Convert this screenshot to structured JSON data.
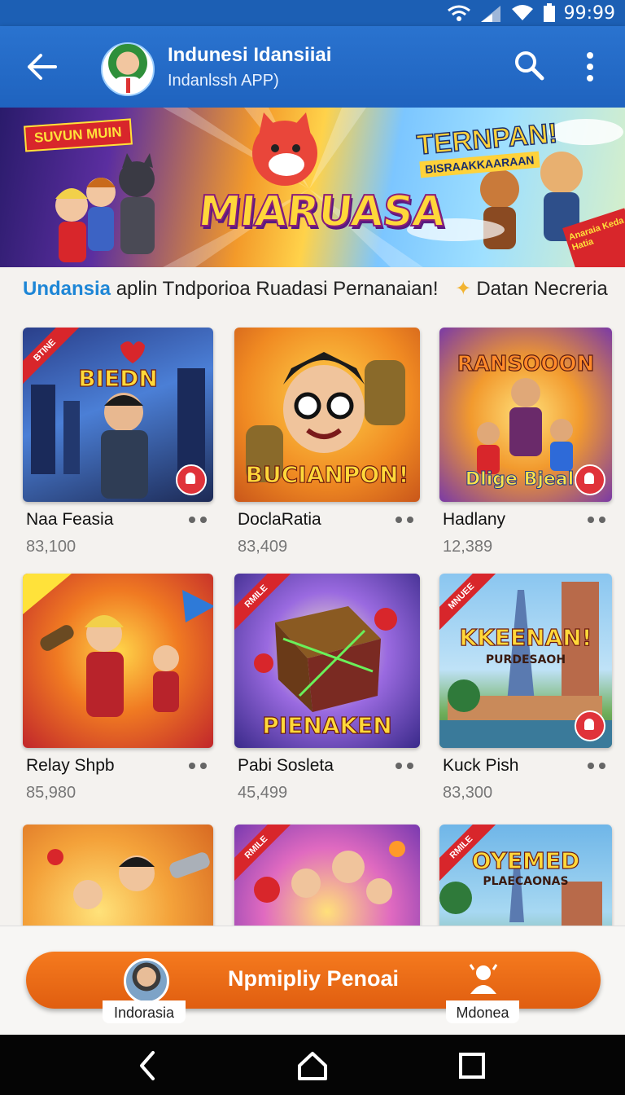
{
  "status_bar": {
    "time": "99:99"
  },
  "header": {
    "title": "Indunesi Idansiiai",
    "subtitle": "Indanlssh APP)"
  },
  "banner": {
    "tag": "SUVUN MUIN",
    "main_title": "MIARUASA",
    "side_title": "TERNPAN!",
    "side_subtitle": "BISRAAKKAARAAN",
    "corner_text": "Anaraia Keda Hatia"
  },
  "tagline": {
    "brand": "Undansia",
    "text": "aplin Tndporioa Ruadasi Pernanaian!",
    "extra": "Datan Necreria"
  },
  "games": [
    {
      "name": "Naa Feasia",
      "count": "83,100",
      "art_title": "BIEDN",
      "ribbon": "BTINE"
    },
    {
      "name": "DoclaRatia",
      "count": "83,409",
      "art_title": "BUCIANPON!",
      "ribbon": ""
    },
    {
      "name": "Hadlany",
      "count": "12,389",
      "art_title": "RANSOOON",
      "art_title2": "Dlige Bjeale",
      "ribbon": ""
    },
    {
      "name": "Relay Shpb",
      "count": "85,980",
      "art_title": "",
      "ribbon": ""
    },
    {
      "name": "Pabi Sosleta",
      "count": "45,499",
      "art_title": "PIENAKEN",
      "ribbon": "RMILE"
    },
    {
      "name": "Kuck Pish",
      "count": "83,300",
      "art_title": "KKEENAN!",
      "art_title2": "PURDESAOH",
      "ribbon": "MNUEE"
    },
    {
      "name": "",
      "count": "",
      "art_title": "",
      "ribbon": ""
    },
    {
      "name": "",
      "count": "",
      "art_title": "",
      "ribbon": "RMILE"
    },
    {
      "name": "",
      "count": "",
      "art_title": "OYEMED",
      "art_title2": "PLAECAONAS",
      "ribbon": "RMILE"
    }
  ],
  "cta": {
    "label": "Npmipliy Penoai"
  },
  "bottom_tabs": {
    "left": "Indorasia",
    "right": "Mdonea"
  },
  "colors": {
    "appbar": "#2a73cf",
    "cta": "#f0701a",
    "brand": "#1d86d6"
  }
}
